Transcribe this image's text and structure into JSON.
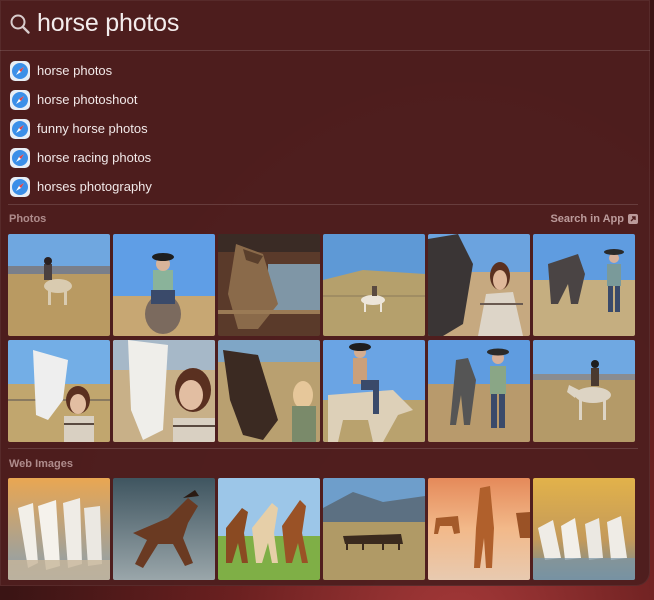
{
  "search": {
    "query": "horse photos"
  },
  "suggestions": [
    {
      "label": "horse photos",
      "icon": "safari-compass-icon"
    },
    {
      "label": "horse photoshoot",
      "icon": "safari-compass-icon"
    },
    {
      "label": "funny horse photos",
      "icon": "safari-compass-icon"
    },
    {
      "label": "horse racing photos",
      "icon": "safari-compass-icon"
    },
    {
      "label": "horses photography",
      "icon": "safari-compass-icon"
    }
  ],
  "photos_section": {
    "title": "Photos",
    "action_label": "Search in App",
    "action_icon": "arrow-up-right-square-icon"
  },
  "web_section": {
    "title": "Web Images"
  },
  "colors": {
    "panel": "#4e1e1e",
    "accent_safari": "#3b8fe8"
  }
}
